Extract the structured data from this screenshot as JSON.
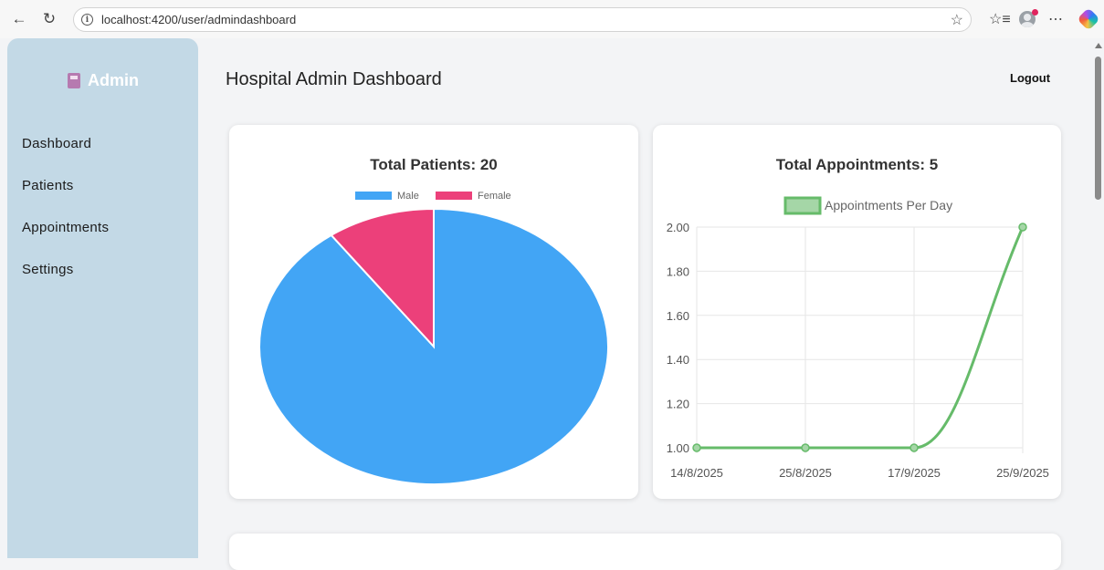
{
  "browser": {
    "url": "localhost:4200/user/admindashboard"
  },
  "sidebar": {
    "brand": "Admin",
    "items": [
      {
        "label": "Dashboard"
      },
      {
        "label": "Patients"
      },
      {
        "label": "Appointments"
      },
      {
        "label": "Settings"
      }
    ]
  },
  "header": {
    "title": "Hospital Admin Dashboard",
    "logout_label": "Logout"
  },
  "colors": {
    "sidebar": "#c3d9e6",
    "male": "#42a5f5",
    "female": "#ec407a",
    "line": "#66bb6a"
  },
  "icons": [
    "back-arrow-icon",
    "reload-icon",
    "info-icon",
    "star-icon",
    "favorites-icon",
    "profile-icon",
    "more-icon",
    "copilot-icon",
    "book-icon"
  ],
  "chart_data": [
    {
      "type": "pie",
      "title": "Total Patients: 20",
      "legend_position": "top",
      "series": [
        {
          "name": "Male",
          "value": 18,
          "color": "#42a5f5"
        },
        {
          "name": "Female",
          "value": 2,
          "color": "#ec407a"
        }
      ]
    },
    {
      "type": "line",
      "title": "Total Appointments: 5",
      "legend_position": "top",
      "categories": [
        "14/8/2025",
        "25/8/2025",
        "17/9/2025",
        "25/9/2025"
      ],
      "series": [
        {
          "name": "Appointments Per Day",
          "values": [
            1,
            1,
            1,
            2
          ],
          "color": "#66bb6a"
        }
      ],
      "ylim": [
        1,
        2
      ],
      "yticks": [
        "1.00",
        "1.20",
        "1.40",
        "1.60",
        "1.80",
        "2.00"
      ],
      "grid": true
    }
  ]
}
